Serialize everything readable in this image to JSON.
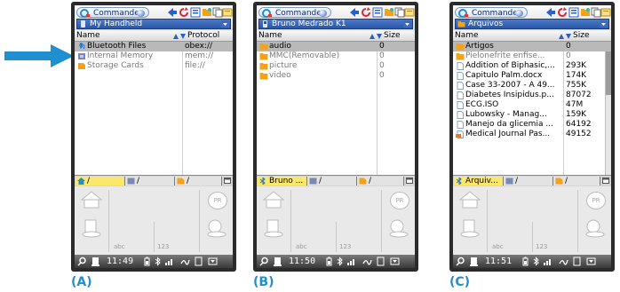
{
  "panels": [
    {
      "caption": "(A)",
      "app_title": "Commander",
      "path": "My Handheld",
      "path_icon": "handheld-icon",
      "columns": {
        "name": "Name",
        "second": "Protocol"
      },
      "rows": [
        {
          "name": "Bluetooth Files",
          "value": "obex://",
          "icon": "bluetooth-icon",
          "selected": true,
          "dim": false
        },
        {
          "name": "Internal Memory",
          "value": "mem://",
          "icon": "memory-icon",
          "selected": false,
          "dim": true
        },
        {
          "name": "Storage Cards",
          "value": "file://",
          "icon": "card-icon",
          "selected": false,
          "dim": true
        }
      ],
      "tabs": [
        {
          "label": "/",
          "icon": "home-icon",
          "active": true
        },
        {
          "label": "/",
          "icon": "memory-icon",
          "active": false
        },
        {
          "label": "/",
          "icon": "card-icon",
          "active": false
        }
      ],
      "time": "11:49"
    },
    {
      "caption": "(B)",
      "app_title": "Commander",
      "path": "Bruno Medrado K1",
      "path_icon": "device-icon",
      "columns": {
        "name": "Name",
        "second": "Size"
      },
      "rows": [
        {
          "name": "audio",
          "value": "0",
          "icon": "folder-icon",
          "selected": true,
          "dim": false
        },
        {
          "name": "MMC(Removable)",
          "value": "0",
          "icon": "folder-icon",
          "selected": false,
          "dim": true
        },
        {
          "name": "picture",
          "value": "0",
          "icon": "folder-icon",
          "selected": false,
          "dim": true
        },
        {
          "name": "video",
          "value": "0",
          "icon": "folder-icon",
          "selected": false,
          "dim": true
        }
      ],
      "tabs": [
        {
          "label": "Bruno ...",
          "icon": "bluetooth-icon",
          "active": true
        },
        {
          "label": "/",
          "icon": "memory-icon",
          "active": false
        },
        {
          "label": "/",
          "icon": "card-icon",
          "active": false
        }
      ],
      "time": "11:50"
    },
    {
      "caption": "(C)",
      "app_title": "Commander",
      "path": "Arquivos",
      "path_icon": "folder-icon",
      "columns": {
        "name": "Name",
        "second": "Size"
      },
      "rows": [
        {
          "name": "Artigos",
          "value": "0",
          "icon": "folder-icon",
          "selected": true,
          "dim": false
        },
        {
          "name": "Pielonefrite enfise...",
          "value": "0",
          "icon": "folder-icon",
          "selected": false,
          "dim": true
        },
        {
          "name": "Addition of Biphasic,...",
          "value": "293K",
          "icon": "file-icon",
          "selected": false,
          "dim": false
        },
        {
          "name": "Capitulo Palm.docx",
          "value": "174K",
          "icon": "file-icon",
          "selected": false,
          "dim": false
        },
        {
          "name": "Case 33-2007 - A 49...",
          "value": "755K",
          "icon": "file-icon",
          "selected": false,
          "dim": false
        },
        {
          "name": "Diabetes Insipidus.p...",
          "value": "87072",
          "icon": "file-icon",
          "selected": false,
          "dim": false
        },
        {
          "name": "ECG.ISO",
          "value": "47M",
          "icon": "file-icon",
          "selected": false,
          "dim": false
        },
        {
          "name": "Lubowsky - Manag...",
          "value": "159K",
          "icon": "file-icon",
          "selected": false,
          "dim": false
        },
        {
          "name": "Manejo da glicemia ...",
          "value": "64192",
          "icon": "file-icon",
          "selected": false,
          "dim": false
        },
        {
          "name": "Medical Journal Pas...",
          "value": "49152",
          "icon": "file-icon",
          "selected": false,
          "dim": false
        }
      ],
      "tabs": [
        {
          "label": "Arquiv...",
          "icon": "bluetooth-icon",
          "active": true
        },
        {
          "label": "/",
          "icon": "memory-icon",
          "active": false
        },
        {
          "label": "/",
          "icon": "card-icon",
          "active": false
        }
      ],
      "time": "11:51"
    }
  ],
  "graffiti": {
    "left_label": "abc",
    "right_label": "123",
    "pr_label": "PR"
  },
  "colors": {
    "accent": "#1f8fcf",
    "selection": "#b9b9b9",
    "active_tab": "#fbe86a",
    "path_bar": "#2a56a8",
    "folder": "#f5a21b"
  }
}
